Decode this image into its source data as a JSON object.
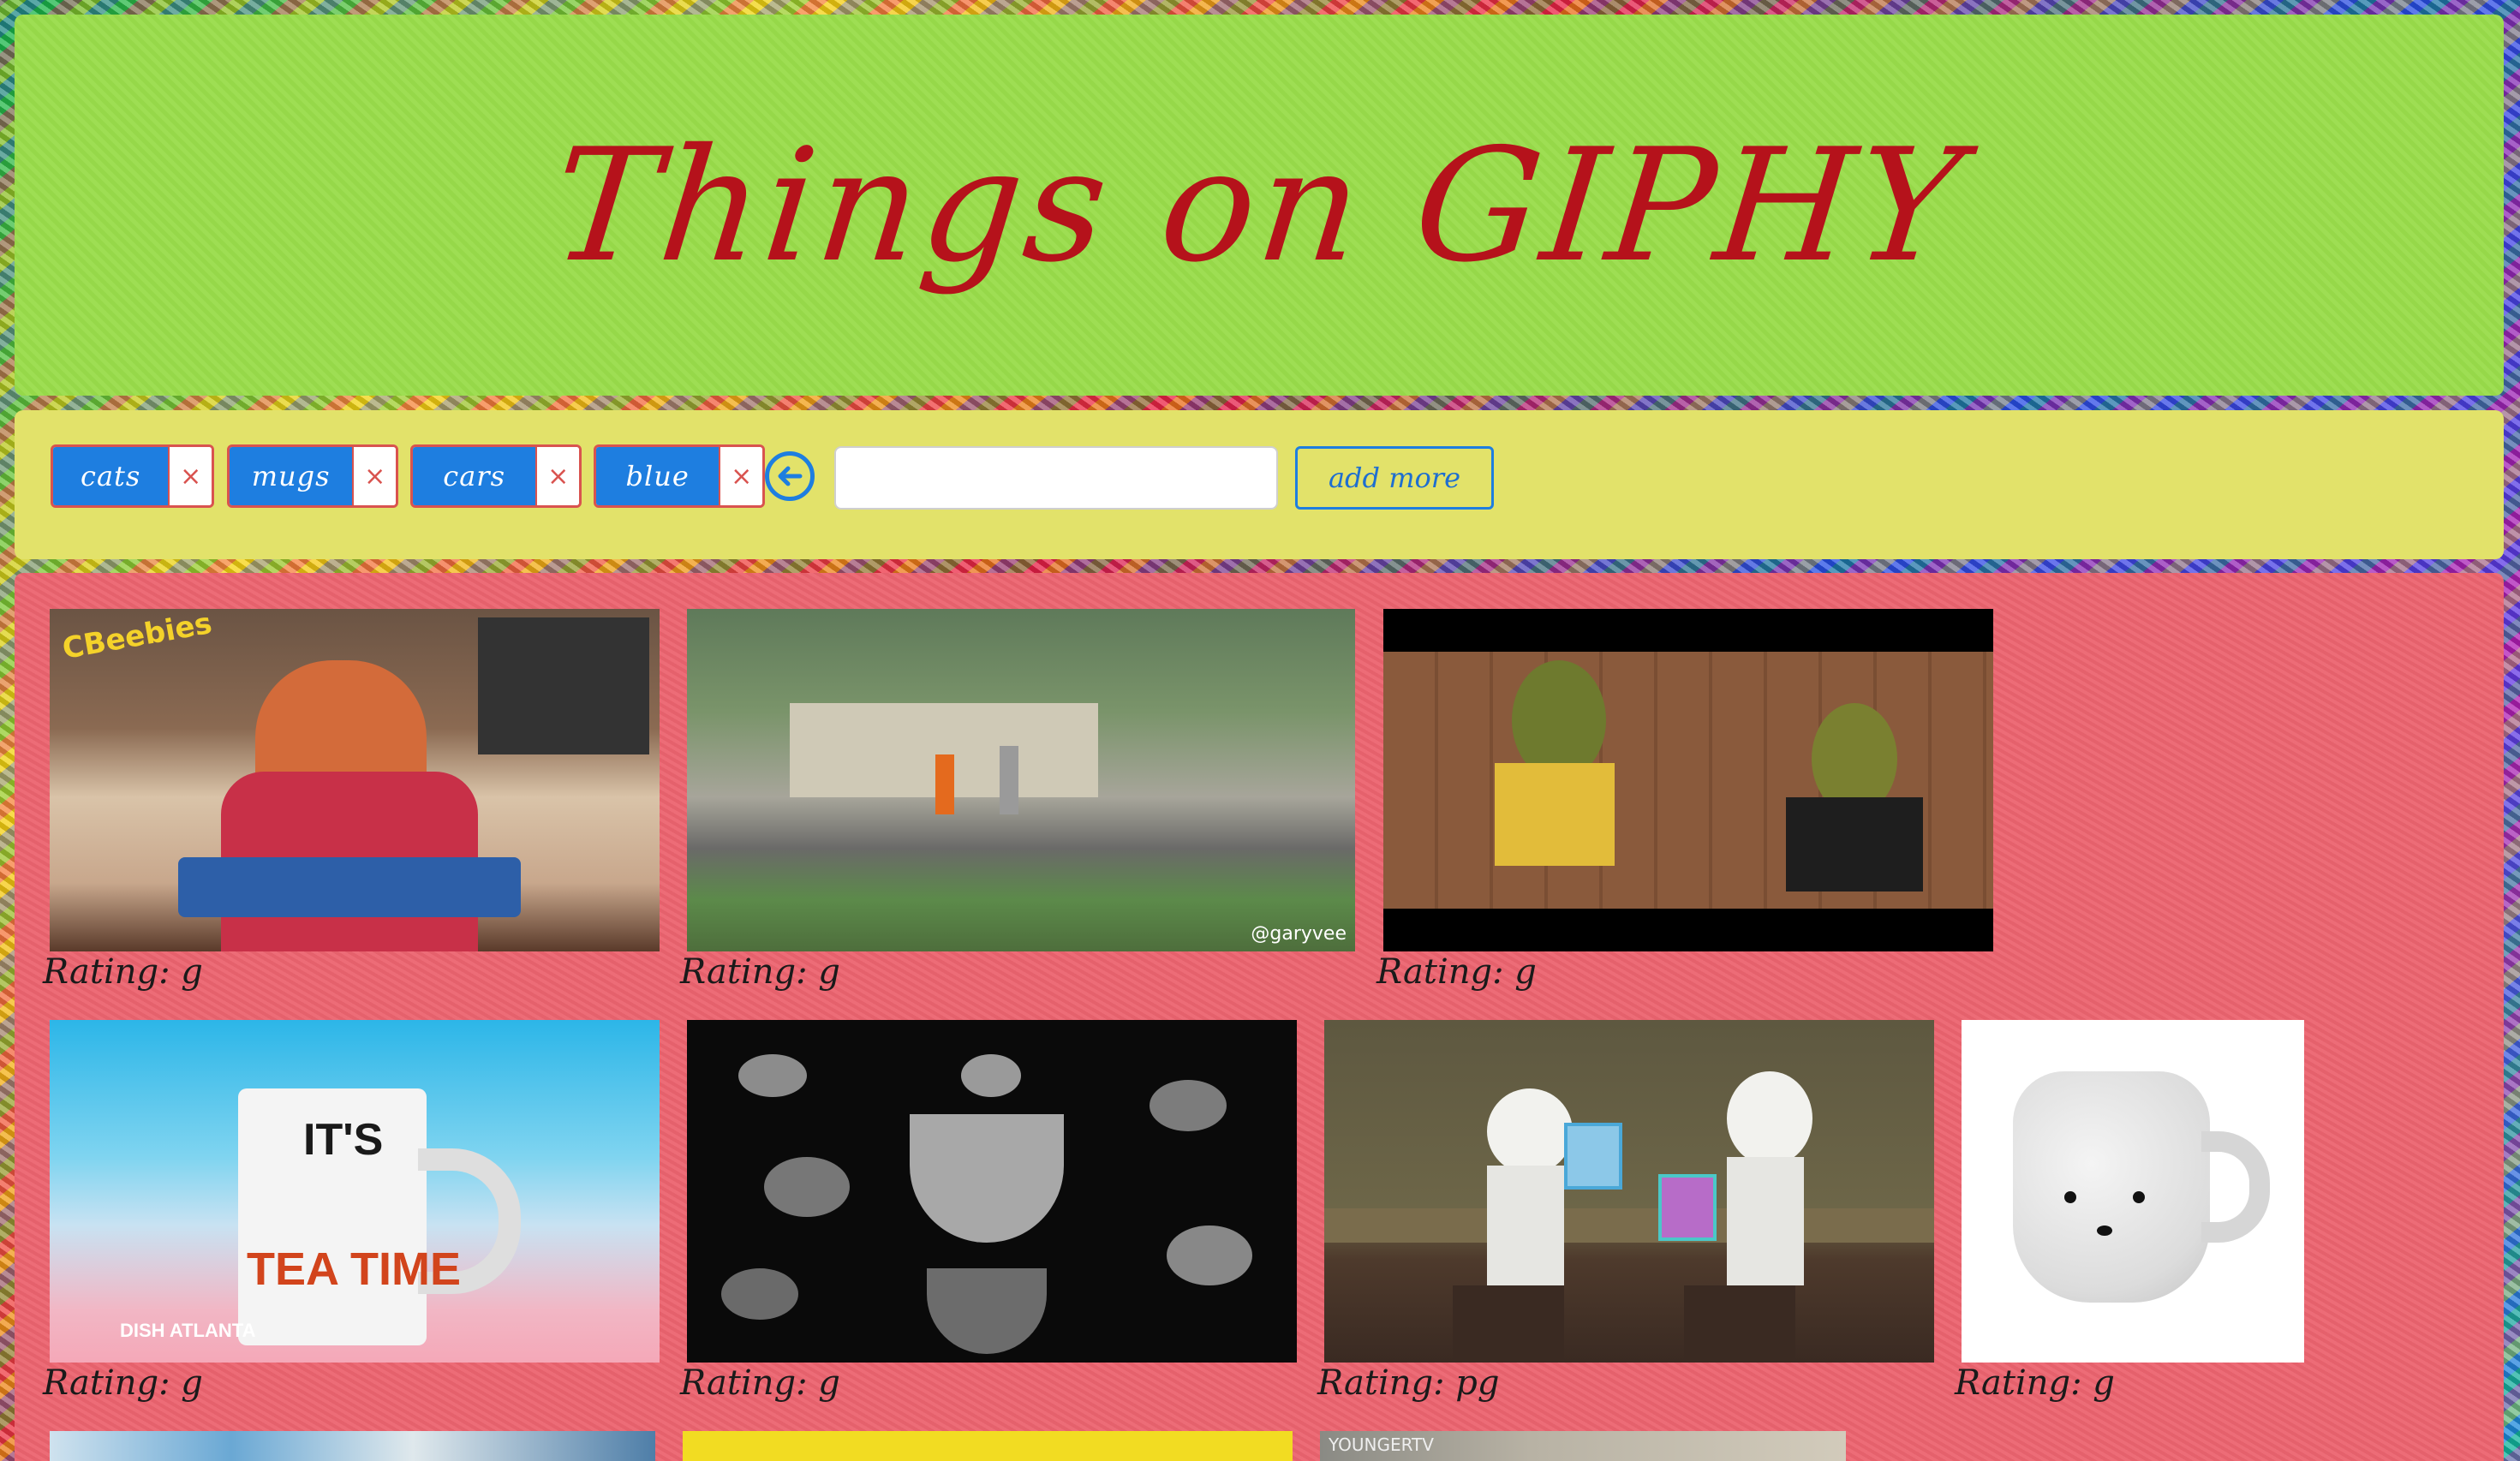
{
  "header": {
    "title": "Things on GIPHY"
  },
  "tags": [
    {
      "label": "cats",
      "remove": "×"
    },
    {
      "label": "mugs",
      "remove": "×"
    },
    {
      "label": "cars",
      "remove": "×"
    },
    {
      "label": "blue",
      "remove": "×"
    }
  ],
  "search": {
    "value": "",
    "placeholder": ""
  },
  "add_more_label": "add more",
  "gifs": [
    {
      "rating": "Rating: g",
      "caption": "CBeebies"
    },
    {
      "rating": "Rating: g",
      "caption": "@garyvee"
    },
    {
      "rating": "Rating: g"
    },
    {
      "rating": "Rating: g",
      "mug_text_1": "IT'S",
      "mug_text_2": "TEA TIME",
      "caption": "DISH ATLANTA"
    },
    {
      "rating": "Rating: g"
    },
    {
      "rating": "Rating: pg"
    },
    {
      "rating": "Rating: g"
    },
    {
      "rating": ""
    },
    {
      "rating": ""
    },
    {
      "rating": "",
      "caption": "YOUNGERTV"
    }
  ],
  "colors": {
    "header_bg": "#99dc4a",
    "title": "#b5121b",
    "toolbar_bg": "#e2e26a",
    "tag_bg": "#1e7ee0",
    "tag_remove": "#d9534f",
    "gallery_bg": "#ec6470"
  }
}
